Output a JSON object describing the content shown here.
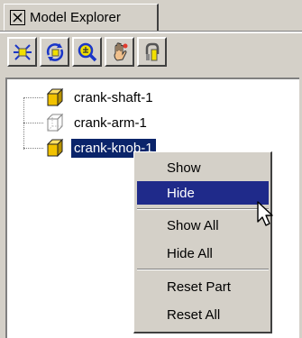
{
  "explorer": {
    "tab_title": "Model Explorer",
    "toolbar": [
      {
        "name": "explode-icon"
      },
      {
        "name": "rotate-icon"
      },
      {
        "name": "zoom-icon"
      },
      {
        "name": "pan-hand-icon"
      },
      {
        "name": "fit-icon"
      }
    ],
    "tree": [
      {
        "label": "crank-shaft-1",
        "icon": "solid-cube-icon"
      },
      {
        "label": "crank-arm-1",
        "icon": "wireframe-cube-icon"
      },
      {
        "label": "crank-knob-1",
        "icon": "solid-cube-icon",
        "selected": true
      }
    ]
  },
  "context_menu": {
    "items": [
      "Show",
      "Hide",
      "Show All",
      "Hide All",
      "Reset Part",
      "Reset All"
    ],
    "highlighted": "Hide"
  },
  "colors": {
    "selection": "#0a246a",
    "menu_highlight": "#1f2a8a",
    "cube_yellow": "#f2c200"
  }
}
